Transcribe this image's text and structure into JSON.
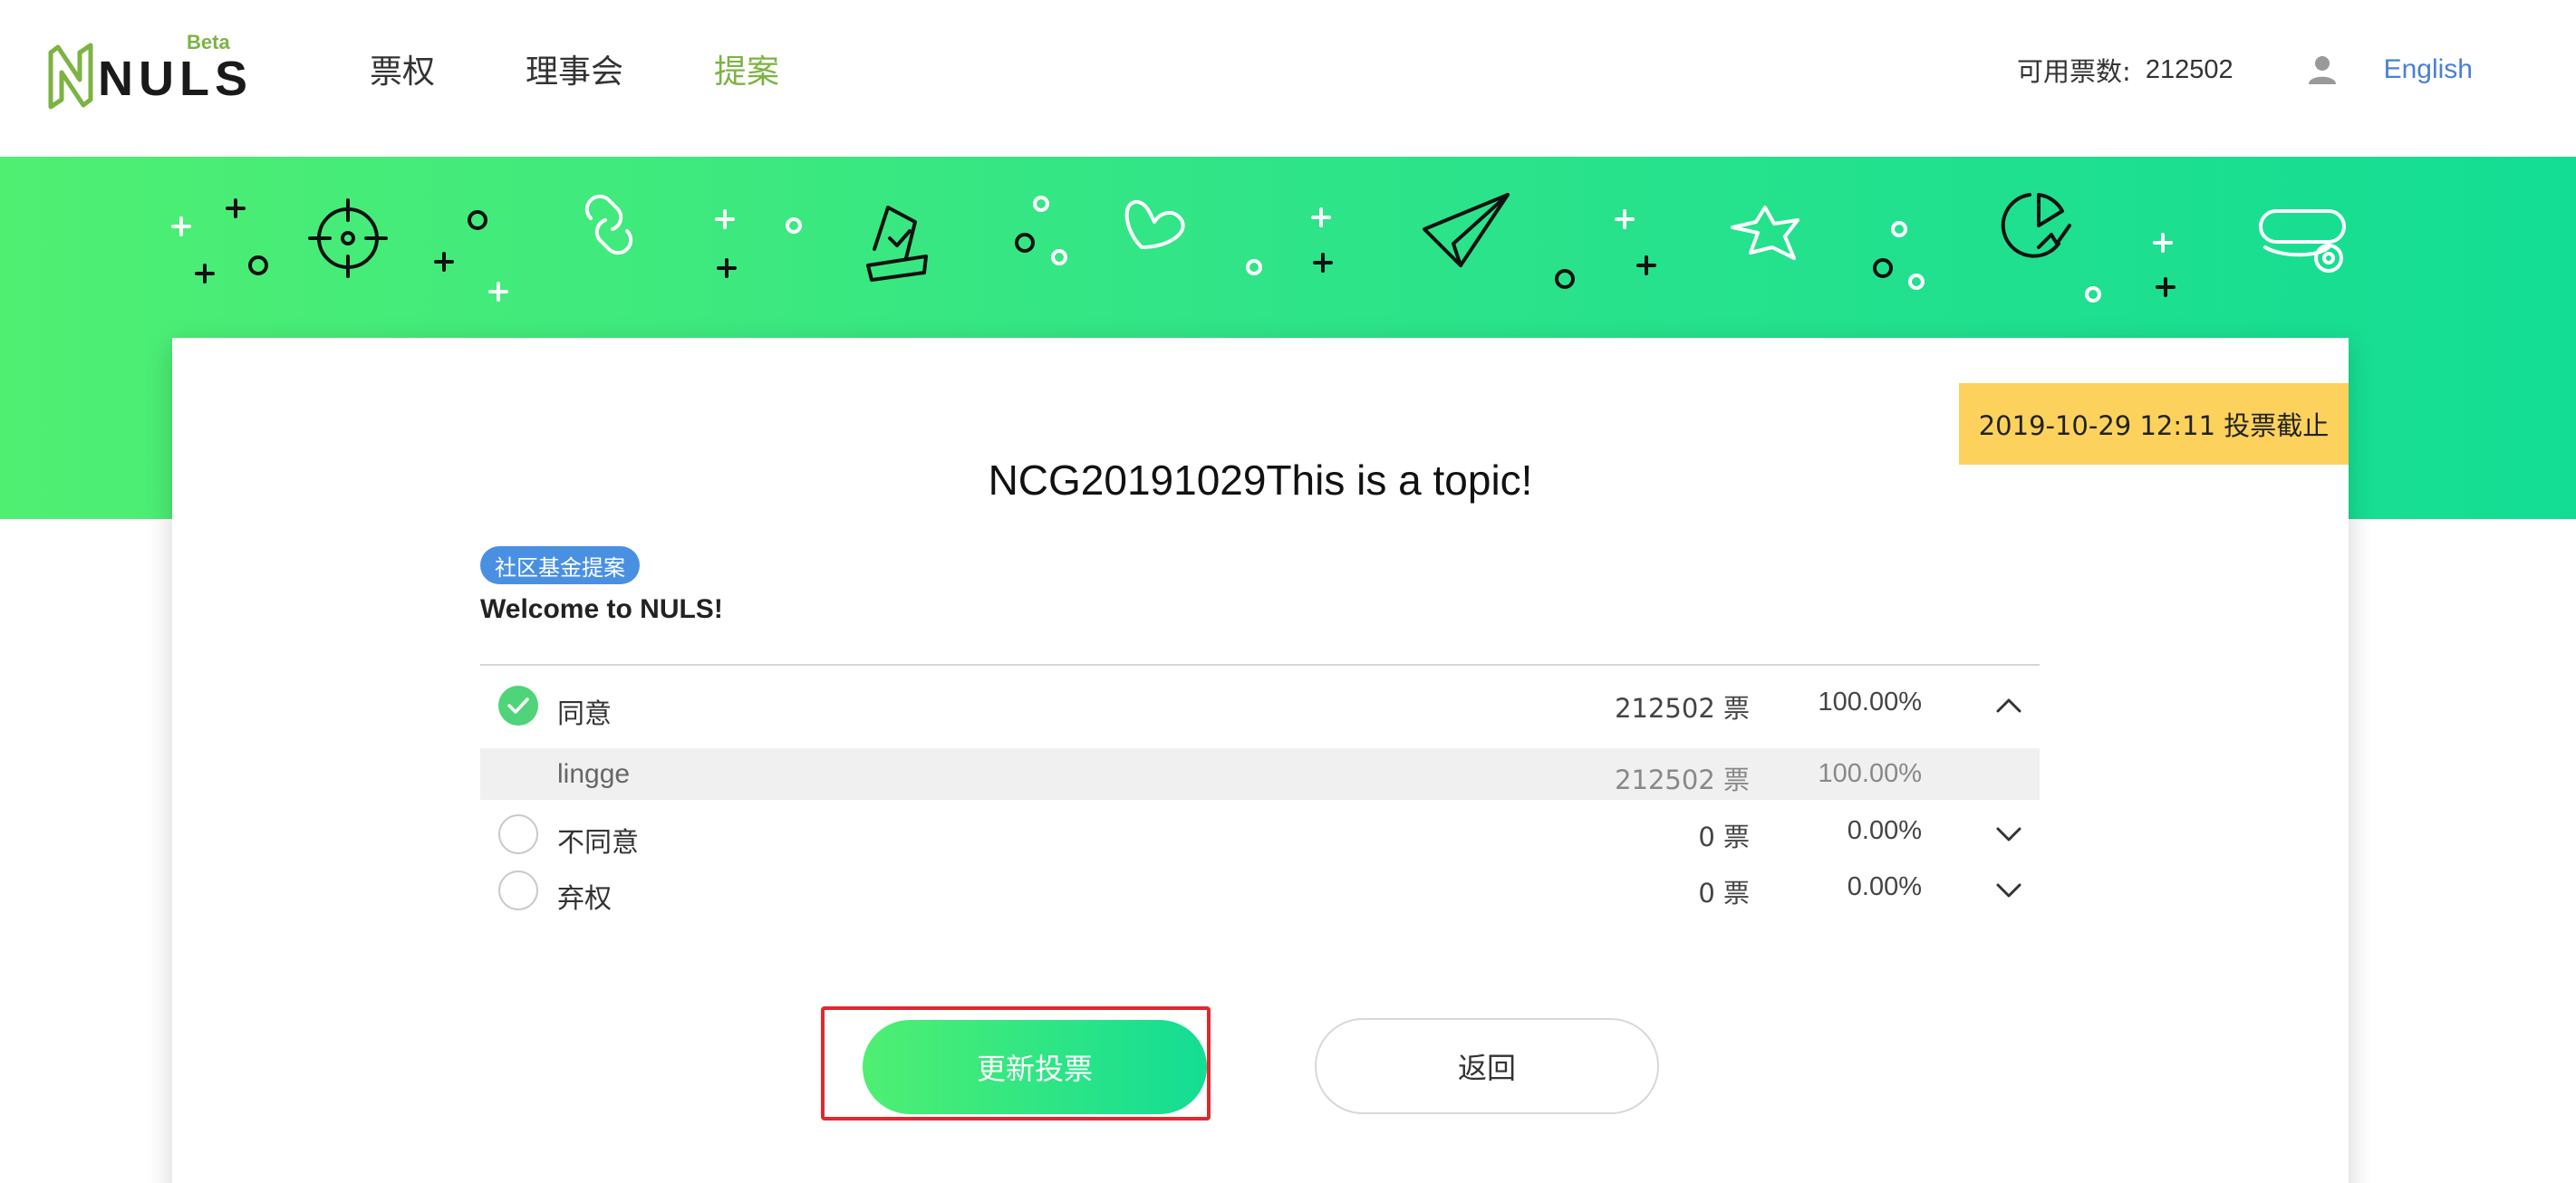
{
  "header": {
    "logo_text": "NULS",
    "logo_badge": "Beta",
    "nav": [
      {
        "label": "票权",
        "active": false
      },
      {
        "label": "理事会",
        "active": false
      },
      {
        "label": "提案",
        "active": true
      }
    ],
    "votes_label": "可用票数:",
    "votes_value": "212502",
    "user_icon": "user-icon",
    "language": "English"
  },
  "colors": {
    "accent": "#7cb342",
    "gradient_start": "#4fef72",
    "gradient_end": "#13dd94",
    "deadline_bg": "#fdd25c",
    "tag_bg": "#4a90e2",
    "link": "#4a7fd6",
    "highlight_border": "#e0282e"
  },
  "proposal": {
    "deadline": "2019-10-29 12:11 投票截止",
    "title": "NCG20191029This is a topic!",
    "tag": "社区基金提案",
    "description": "Welcome to NULS!",
    "options": [
      {
        "label": "同意",
        "votes": "212502 票",
        "percent": "100.00%",
        "checked": true,
        "expanded": true,
        "voters": [
          {
            "name": "lingge",
            "votes": "212502 票",
            "percent": "100.00%"
          }
        ]
      },
      {
        "label": "不同意",
        "votes": "0 票",
        "percent": "0.00%",
        "checked": false,
        "expanded": false
      },
      {
        "label": "弃权",
        "votes": "0 票",
        "percent": "0.00%",
        "checked": false,
        "expanded": false
      }
    ]
  },
  "actions": {
    "update_vote": "更新投票",
    "back": "返回"
  }
}
